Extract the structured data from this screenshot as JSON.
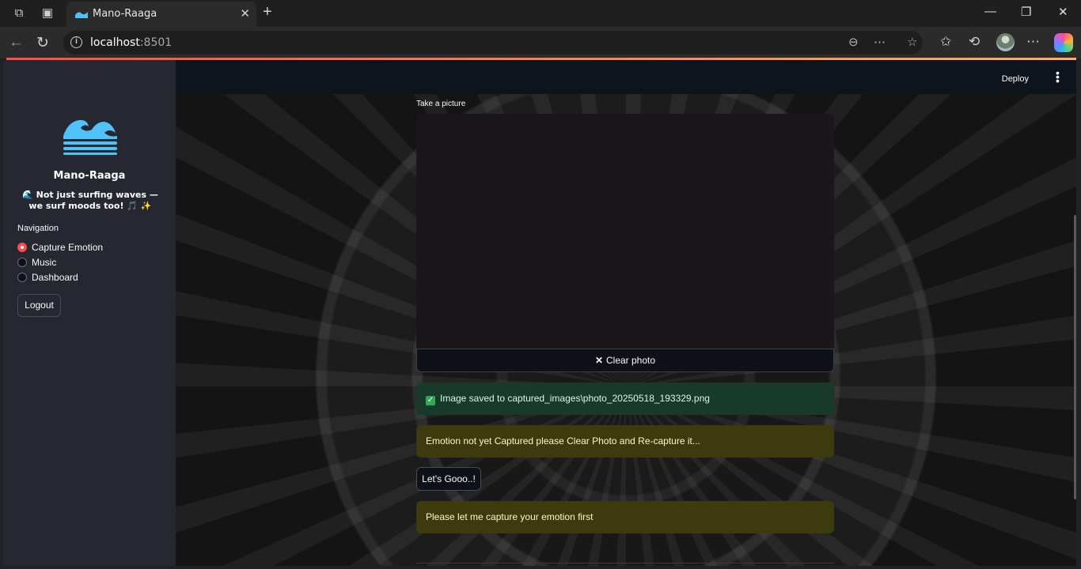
{
  "browser": {
    "tab_title": "Mano-Raaga",
    "url_host": "localhost",
    "url_port": ":8501"
  },
  "app": {
    "name": "Mano-Raaga",
    "tagline": "🌊 Not just surfing waves — we surf moods too! 🎵 ✨",
    "deploy_label": "Deploy"
  },
  "sidebar": {
    "nav_label": "Navigation",
    "options": [
      {
        "label": "Capture Emotion",
        "selected": true
      },
      {
        "label": "Music",
        "selected": false
      },
      {
        "label": "Dashboard",
        "selected": false
      }
    ],
    "logout_label": "Logout"
  },
  "main": {
    "camera_label": "Take a picture",
    "clear_photo_label": "Clear photo",
    "success_message": "Image saved to captured_images\\photo_20250518_193329.png",
    "warning_message": "Emotion not yet Captured please Clear Photo and Re-capture it...",
    "go_button_label": "Let's Gooo..!",
    "info_message": "Please let me capture your emotion first"
  },
  "colors": {
    "accent": "#ff4b4b",
    "sidebar_bg": "#262730",
    "success_bg": "#173a2a",
    "warning_bg": "#3d3a0d"
  }
}
